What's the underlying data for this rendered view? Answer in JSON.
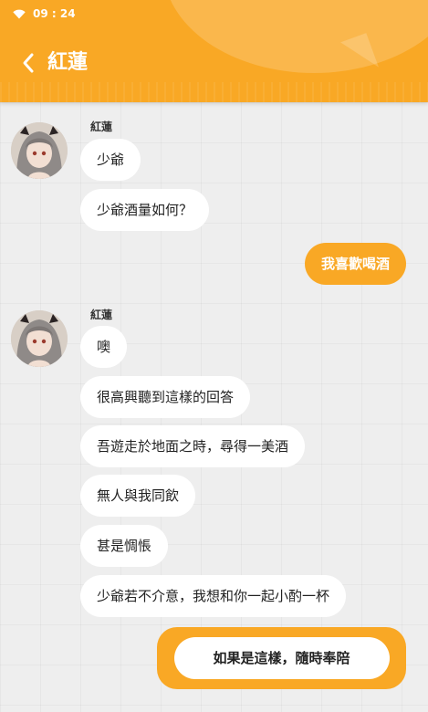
{
  "status_bar": {
    "time": "09 : 24"
  },
  "header": {
    "title": "紅蓮"
  },
  "messages": [
    {
      "sender": "紅蓮",
      "bubbles": [
        "少爺",
        "少爺酒量如何？"
      ]
    },
    {
      "me": "我喜歡喝酒"
    },
    {
      "sender": "紅蓮",
      "bubbles": [
        "噢",
        "很高興聽到這樣的回答",
        "吾遊走於地面之時，尋得一美酒",
        "無人與我同飲",
        "甚是惆悵",
        "少爺若不介意，我想和你一起小酌一杯"
      ]
    }
  ],
  "reply_option": "如果是這樣，隨時奉陪",
  "colors": {
    "accent": "#f9a825",
    "background": "#eeeeee",
    "bubble": "#ffffff"
  },
  "icons": {
    "back": "chevron-left-icon",
    "wifi": "wifi-icon"
  }
}
